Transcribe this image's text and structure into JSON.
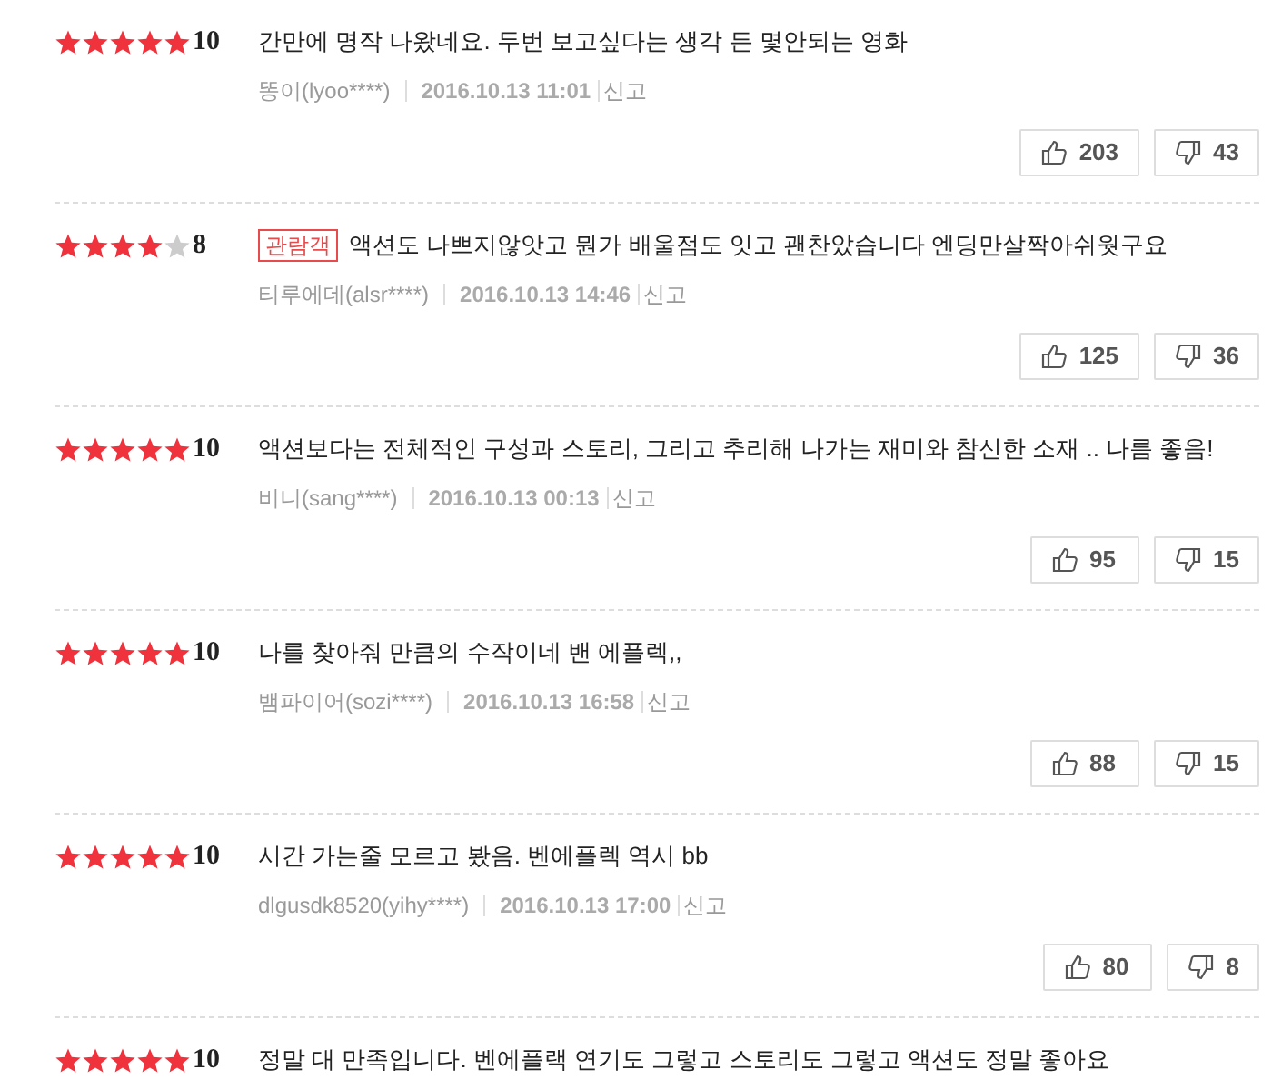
{
  "reviews": [
    {
      "stars": 5,
      "score": "10",
      "text": "간만에 명작 나왔네요. 두번 보고싶다는 생각 든 몇안되는 영화",
      "author": "똥이(lyoo****)",
      "date": "2016.10.13 11:01",
      "report": "신고",
      "likes": "203",
      "dislikes": "43"
    },
    {
      "stars": 4,
      "score": "8",
      "badge": "관람객",
      "text": "액션도 나쁘지않앗고 뭔가 배울점도 잇고 괜찬았습니다 엔딩만살짝아쉬웟구요",
      "author": "티루에데(alsr****)",
      "date": "2016.10.13 14:46",
      "report": "신고",
      "likes": "125",
      "dislikes": "36"
    },
    {
      "stars": 5,
      "score": "10",
      "text": "액션보다는 전체적인 구성과 스토리, 그리고 추리해 나가는 재미와 참신한 소재 .. 나름 좋음!",
      "author": "비니(sang****)",
      "date": "2016.10.13 00:13",
      "report": "신고",
      "likes": "95",
      "dislikes": "15"
    },
    {
      "stars": 5,
      "score": "10",
      "text": "나를 찾아줘 만큼의 수작이네 밴 에플렉,,",
      "author": "뱀파이어(sozi****)",
      "date": "2016.10.13 16:58",
      "report": "신고",
      "likes": "88",
      "dislikes": "15"
    },
    {
      "stars": 5,
      "score": "10",
      "text": "시간 가는줄 모르고 봤음. 벤에플렉 역시 bb",
      "author": "dlgusdk8520(yihy****)",
      "date": "2016.10.13 17:00",
      "report": "신고",
      "likes": "80",
      "dislikes": "8"
    },
    {
      "stars": 5,
      "score": "10",
      "text": "정말 대 만족입니다. 벤에플랙 연기도 그렇고 스토리도 그렇고 액션도 정말 좋아요"
    }
  ]
}
